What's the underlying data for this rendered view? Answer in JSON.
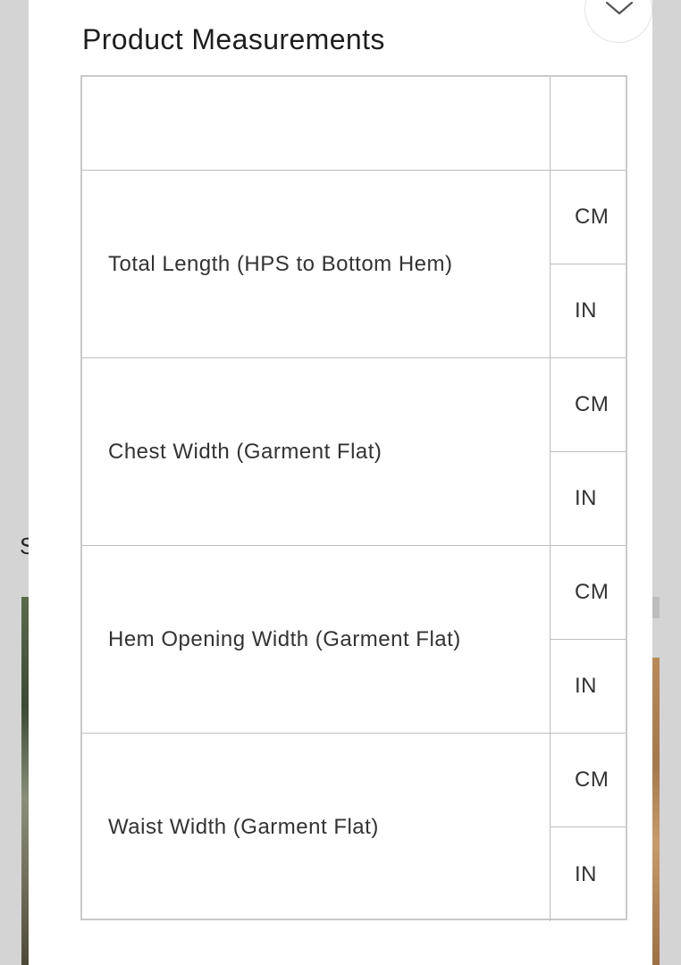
{
  "modal": {
    "title": "Product Measurements",
    "close_icon": "chevron-down-icon"
  },
  "background": {
    "partial_letter": "S"
  },
  "table": {
    "rows": [
      {
        "label": "Total Length (HPS to Bottom Hem)",
        "units": [
          "CM",
          "IN"
        ]
      },
      {
        "label": "Chest Width (Garment Flat)",
        "units": [
          "CM",
          "IN"
        ]
      },
      {
        "label": "Hem Opening Width (Garment Flat)",
        "units": [
          "CM",
          "IN"
        ]
      },
      {
        "label": "Waist Width (Garment Flat)",
        "units": [
          "CM",
          "IN"
        ]
      }
    ]
  }
}
